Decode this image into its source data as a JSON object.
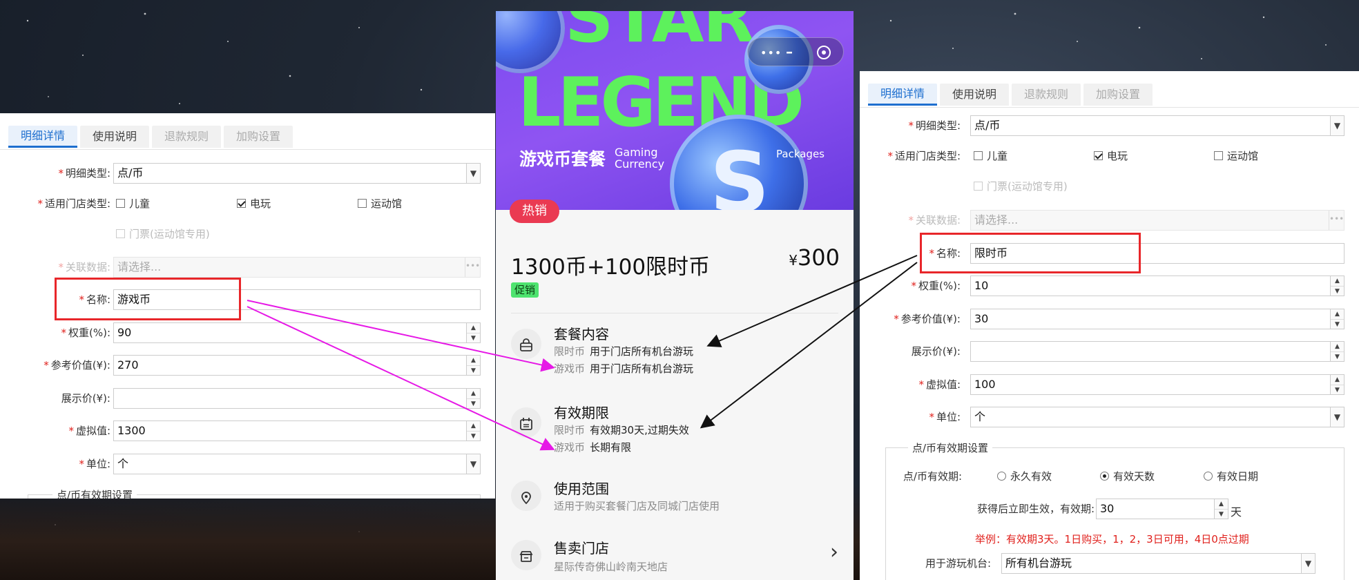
{
  "left_form": {
    "tabs": [
      "明细详情",
      "使用说明",
      "退款规则",
      "加购设置"
    ],
    "detail_type": {
      "label": "明细类型:",
      "value": "点/币"
    },
    "store_type": {
      "label": "适用门店类型:",
      "options": [
        {
          "label": "儿童",
          "checked": false
        },
        {
          "label": "电玩",
          "checked": true
        },
        {
          "label": "运动馆",
          "checked": false
        }
      ],
      "ticket": "门票(运动馆专用)"
    },
    "related": {
      "label": "关联数据:",
      "placeholder": "请选择..."
    },
    "name": {
      "label": "名称:",
      "value": "游戏币"
    },
    "weight": {
      "label": "权重(%):",
      "value": "90"
    },
    "ref_value": {
      "label": "参考价值(¥):",
      "value": "270"
    },
    "display_price": {
      "label": "展示价(¥):",
      "value": ""
    },
    "virtual_value": {
      "label": "虚拟值:",
      "value": "1300"
    },
    "unit": {
      "label": "单位:",
      "value": "个"
    },
    "section_partial": "点/币有效期设置"
  },
  "phone": {
    "banner": {
      "title_line1": "STAR",
      "title_line2": "LEGEND",
      "sub_cn": "游戏币套餐",
      "sub_en1": "Gaming Currency",
      "sub_en2": "Packages",
      "coin_letter": "S",
      "capsule_dots": "•••"
    },
    "hot_badge": "热销",
    "title": "1300币+100限时币",
    "price_symbol": "¥",
    "price": "300",
    "promo_tag": "促销",
    "sections": {
      "content": {
        "title": "套餐内容",
        "lines": [
          {
            "k": "限时币",
            "v": "用于门店所有机台游玩"
          },
          {
            "k": "游戏币",
            "v": "用于门店所有机台游玩"
          }
        ]
      },
      "validity": {
        "title": "有效期限",
        "lines": [
          {
            "k": "限时币",
            "v": "有效期30天,过期失效"
          },
          {
            "k": "游戏币",
            "v": "长期有限"
          }
        ]
      },
      "scope": {
        "title": "使用范围",
        "desc": "适用于购买套餐门店及同城门店使用"
      },
      "stores": {
        "title": "售卖门店",
        "desc": "星际传奇佛山岭南天地店"
      }
    }
  },
  "right_form": {
    "tabs": [
      "明细详情",
      "使用说明",
      "退款规则",
      "加购设置"
    ],
    "detail_type": {
      "label": "明细类型:",
      "value": "点/币"
    },
    "store_type": {
      "label": "适用门店类型:",
      "options": [
        {
          "label": "儿童",
          "checked": false
        },
        {
          "label": "电玩",
          "checked": true
        },
        {
          "label": "运动馆",
          "checked": false
        }
      ],
      "ticket": "门票(运动馆专用)"
    },
    "related": {
      "label": "关联数据:",
      "placeholder": "请选择..."
    },
    "name": {
      "label": "名称:",
      "value": "限时币"
    },
    "weight": {
      "label": "权重(%):",
      "value": "10"
    },
    "ref_value": {
      "label": "参考价值(¥):",
      "value": "30"
    },
    "display_price": {
      "label": "展示价(¥):",
      "value": ""
    },
    "virtual_value": {
      "label": "虚拟值:",
      "value": "100"
    },
    "unit": {
      "label": "单位:",
      "value": "个"
    },
    "validity_section": {
      "legend": "点/币有效期设置",
      "label": "点/币有效期:",
      "options": [
        {
          "label": "永久有效",
          "selected": false
        },
        {
          "label": "有效天数",
          "selected": true
        },
        {
          "label": "有效日期",
          "selected": false
        }
      ],
      "days_label": "获得后立即生效，有效期:",
      "days_value": "30",
      "days_unit": "天",
      "example": "举例：有效期3天。1日购买，1，2，3日可用，4日0点过期",
      "machine_label": "用于游玩机台:",
      "machine_value": "所有机台游玩"
    }
  },
  "colors": {
    "accent_blue": "#1e6fcf",
    "required_red": "#e0201c",
    "highlight_red": "#e8262a",
    "arrow_magenta": "#e619e6",
    "arrow_black": "#111111",
    "banner_purple": "#8f54f2",
    "banner_green": "#5df15c",
    "hot_badge": "#ea3a52",
    "promo_green": "#4ee36f"
  },
  "icons": {
    "dropdown": "chevron-down-icon",
    "spinner": "spin-up-down-icon",
    "content": "bag-icon",
    "validity": "calendar-icon",
    "scope": "map-pin-icon",
    "stores": "shop-icon",
    "forward": "chevron-right-icon"
  }
}
